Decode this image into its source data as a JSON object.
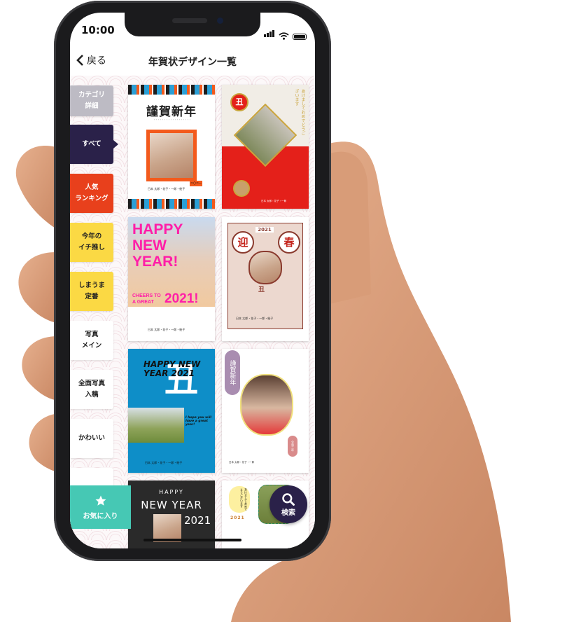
{
  "status_bar": {
    "time": "10:00"
  },
  "nav": {
    "back_label": "戻る",
    "title": "年賀状デザイン一覧"
  },
  "categories": [
    {
      "label": "カテゴリ\n詳細",
      "bg": "#bdbbc4",
      "fg": "#ffffff"
    },
    {
      "label": "すべて",
      "bg": "#2a2149",
      "fg": "#ffffff",
      "selected": true
    },
    {
      "label": "人気\nランキング",
      "bg": "#e8401c",
      "fg": "#ffffff"
    },
    {
      "label": "今年の\nイチ推し",
      "bg": "#fbd944",
      "fg": "#222222"
    },
    {
      "label": "しまうま\n定番",
      "bg": "#fbd944",
      "fg": "#222222"
    },
    {
      "label": "写真\nメイン",
      "bg": "#ffffff",
      "fg": "#222222"
    },
    {
      "label": "全面写真\n入稿",
      "bg": "#ffffff",
      "fg": "#222222"
    },
    {
      "label": "かわいい",
      "bg": "#ffffff",
      "fg": "#222222"
    },
    {
      "label": "",
      "bg": "#ffffff",
      "fg": "#222222"
    }
  ],
  "favorites": {
    "label": "お気に入り",
    "icon": "star-icon",
    "color": "#46c8b4"
  },
  "search": {
    "label": "検索",
    "icon": "search-icon",
    "color": "#2a2149"
  },
  "designs": [
    {
      "headline": "謹賀新年",
      "tag": "二〇二一",
      "names": "日本 太郎・花子・一郎・絵子"
    },
    {
      "headline": "あけましておめでとうございます",
      "names": "日本 太郎・花子・一郎"
    },
    {
      "headline": "HAPPY NEW YEAR!",
      "sub": "CHEERS TO A GREAT",
      "year": "2021!",
      "names": "日本 太郎・花子・一郎・絵子"
    },
    {
      "left": "迎",
      "right": "春",
      "year": "2021",
      "zodiac": "丑",
      "names": "日本 太郎・花子・一郎・絵子"
    },
    {
      "headline": "HAPPY NEW YEAR 2021",
      "zodiac": "丑",
      "sub": "I hope you will have a great year!",
      "names": "日本 太郎・花子・一郎・絵子"
    },
    {
      "headline": "謹賀新年",
      "era": "令和三年",
      "names": "日本 太郎・花子・一郎"
    },
    {
      "headline": "HAPPY",
      "sub": "NEW YEAR",
      "year": "2021"
    },
    {
      "headline": "あけましておめでとうございます",
      "year": "2021"
    }
  ]
}
